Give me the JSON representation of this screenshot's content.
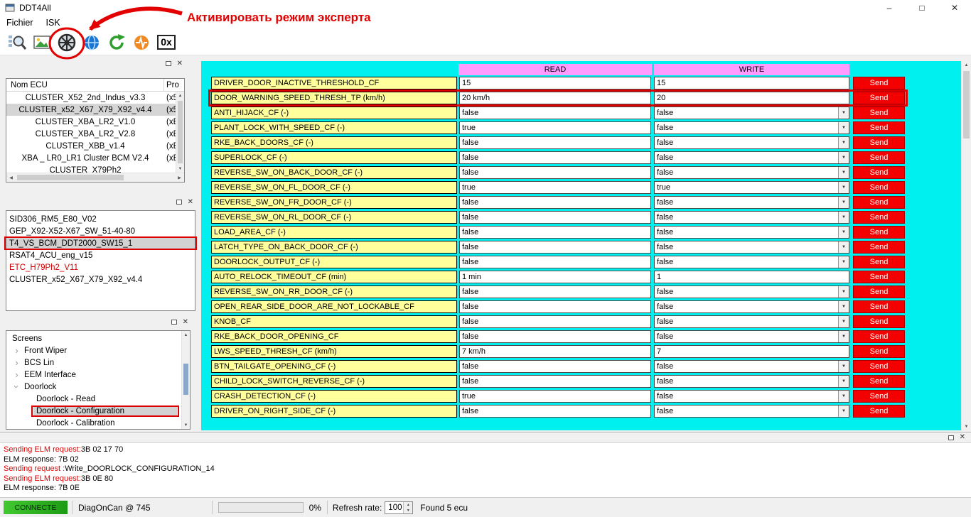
{
  "window": {
    "title": "DDT4All"
  },
  "window_controls": {
    "minimize": "–",
    "maximize": "□",
    "close": "✕"
  },
  "menu": {
    "items": [
      {
        "label": "Fichier"
      },
      {
        "label": "ISK"
      }
    ]
  },
  "toolbar": {
    "hex_label": "0x"
  },
  "annotation": {
    "label": "Активировать режим эксперта"
  },
  "icons": {
    "close": "✕",
    "scroll_up": "▲",
    "scroll_down": "▼",
    "scroll_left": "◀",
    "scroll_right": "▶",
    "dropdown": "▼",
    "spin_up": "▲",
    "spin_down": "▼",
    "tree_collapsed": "›"
  },
  "ecu_panel": {
    "name_header": "Nom ECU",
    "proto_header": "Pro",
    "items": [
      {
        "name": "CLUSTER_X52_2nd_Indus_v3.3",
        "proto": "(x5",
        "selected": false
      },
      {
        "name": "CLUSTER_x52_X67_X79_X92_v4.4",
        "proto": "(x5",
        "selected": true
      },
      {
        "name": "CLUSTER_XBA_LR2_V1.0",
        "proto": "(xB",
        "selected": false
      },
      {
        "name": "CLUSTER_XBA_LR2_V2.8",
        "proto": "(xB",
        "selected": false
      },
      {
        "name": "CLUSTER_XBB_v1.4",
        "proto": "(xB",
        "selected": false
      },
      {
        "name": "XBA _ LR0_LR1 Cluster BCM V2.4",
        "proto": "(xB",
        "selected": false
      },
      {
        "name": "CLUSTER_X79Ph2",
        "proto": "",
        "selected": false
      }
    ]
  },
  "file_panel": {
    "items": [
      {
        "name": "SID306_RM5_E80_V02",
        "selected": false,
        "red": false,
        "outlined": false
      },
      {
        "name": "GEP_X92-X52-X67_SW_51-40-80",
        "selected": false,
        "red": false,
        "outlined": false
      },
      {
        "name": "T4_VS_BCM_DDT2000_SW15_1",
        "selected": true,
        "red": false,
        "outlined": true
      },
      {
        "name": "RSAT4_ACU_eng_v15",
        "selected": false,
        "red": false,
        "outlined": false
      },
      {
        "name": "ETC_H79Ph2_V11",
        "selected": false,
        "red": true,
        "outlined": false
      },
      {
        "name": "CLUSTER_x52_X67_X79_X92_v4.4",
        "selected": false,
        "red": false,
        "outlined": false
      }
    ]
  },
  "screens_panel": {
    "items": [
      {
        "label": "Screens",
        "level": 0,
        "state": "none",
        "selected": false,
        "outlined": false
      },
      {
        "label": "Front Wiper",
        "level": 1,
        "state": "collapsed",
        "selected": false,
        "outlined": false
      },
      {
        "label": "BCS Lin",
        "level": 1,
        "state": "collapsed",
        "selected": false,
        "outlined": false
      },
      {
        "label": "EEM Interface",
        "level": 1,
        "state": "collapsed",
        "selected": false,
        "outlined": false
      },
      {
        "label": "Doorlock",
        "level": 1,
        "state": "expanded",
        "selected": false,
        "outlined": false
      },
      {
        "label": "Doorlock - Read",
        "level": 2,
        "state": "none",
        "selected": false,
        "outlined": false
      },
      {
        "label": "Doorlock - Configuration",
        "level": 2,
        "state": "none",
        "selected": true,
        "outlined": true
      },
      {
        "label": "Doorlock - Calibration",
        "level": 2,
        "state": "none",
        "selected": false,
        "outlined": false
      }
    ]
  },
  "param_table": {
    "read_header": "READ",
    "write_header": "WRITE",
    "send_label": "Send",
    "rows": [
      {
        "label": "DRIVER_DOOR_INACTIVE_THRESHOLD_CF",
        "read": "15",
        "write": "15",
        "type": "input",
        "outlined": false
      },
      {
        "label": "DOOR_WARNING_SPEED_THRESH_TP (km/h)",
        "read": "20 km/h",
        "write": "20",
        "type": "input",
        "outlined": true
      },
      {
        "label": "ANTI_HIJACK_CF (-)",
        "read": "false",
        "write": "false",
        "type": "select",
        "outlined": false
      },
      {
        "label": "PLANT_LOCK_WITH_SPEED_CF (-)",
        "read": "true",
        "write": "false",
        "type": "select",
        "outlined": false
      },
      {
        "label": "RKE_BACK_DOORS_CF (-)",
        "read": "false",
        "write": "false",
        "type": "select",
        "outlined": false
      },
      {
        "label": "SUPERLOCK_CF (-)",
        "read": "false",
        "write": "false",
        "type": "select",
        "outlined": false
      },
      {
        "label": "REVERSE_SW_ON_BACK_DOOR_CF (-)",
        "read": "false",
        "write": "false",
        "type": "select",
        "outlined": false
      },
      {
        "label": "REVERSE_SW_ON_FL_DOOR_CF (-)",
        "read": "true",
        "write": "true",
        "type": "select",
        "outlined": false
      },
      {
        "label": "REVERSE_SW_ON_FR_DOOR_CF (-)",
        "read": "false",
        "write": "false",
        "type": "select",
        "outlined": false
      },
      {
        "label": "REVERSE_SW_ON_RL_DOOR_CF (-)",
        "read": "false",
        "write": "false",
        "type": "select",
        "outlined": false
      },
      {
        "label": "LOAD_AREA_CF (-)",
        "read": "false",
        "write": "false",
        "type": "select",
        "outlined": false
      },
      {
        "label": "LATCH_TYPE_ON_BACK_DOOR_CF (-)",
        "read": "false",
        "write": "false",
        "type": "select",
        "outlined": false
      },
      {
        "label": "DOORLOCK_OUTPUT_CF (-)",
        "read": "false",
        "write": "false",
        "type": "select",
        "outlined": false
      },
      {
        "label": "AUTO_RELOCK_TIMEOUT_CF (min)",
        "read": "1 min",
        "write": "1",
        "type": "input",
        "outlined": false
      },
      {
        "label": "REVERSE_SW_ON_RR_DOOR_CF (-)",
        "read": "false",
        "write": "false",
        "type": "select",
        "outlined": false
      },
      {
        "label": "OPEN_REAR_SIDE_DOOR_ARE_NOT_LOCKABLE_CF",
        "read": "false",
        "write": "false",
        "type": "select",
        "outlined": false
      },
      {
        "label": "KNOB_CF",
        "read": "false",
        "write": "false",
        "type": "select",
        "outlined": false
      },
      {
        "label": "RKE_BACK_DOOR_OPENING_CF",
        "read": "false",
        "write": "false",
        "type": "select",
        "outlined": false
      },
      {
        "label": "LWS_SPEED_THRESH_CF (km/h)",
        "read": "7 km/h",
        "write": "7",
        "type": "input",
        "outlined": false
      },
      {
        "label": "BTN_TAILGATE_OPENING_CF (-)",
        "read": "false",
        "write": "false",
        "type": "select",
        "outlined": false
      },
      {
        "label": "CHILD_LOCK_SWITCH_REVERSE_CF (-)",
        "read": "false",
        "write": "false",
        "type": "select",
        "outlined": false
      },
      {
        "label": "CRASH_DETECTION_CF (-)",
        "read": "true",
        "write": "false",
        "type": "select",
        "outlined": false
      },
      {
        "label": "DRIVER_ON_RIGHT_SIDE_CF (-)",
        "read": "false",
        "write": "false",
        "type": "select",
        "outlined": false
      }
    ]
  },
  "log_panel": {
    "lines": [
      {
        "prefix": "Sending ELM request:",
        "value": "3B 02 17 70",
        "highlight": true
      },
      {
        "prefix": "ELM response: ",
        "value": "7B 02",
        "highlight": false
      },
      {
        "prefix": "Sending request :",
        "value": "Write_DOORLOCK_CONFIGURATION_14",
        "highlight": true
      },
      {
        "prefix": "Sending ELM request:",
        "value": "3B 0E 80",
        "highlight": true
      },
      {
        "prefix": "ELM response: ",
        "value": "7B 0E",
        "highlight": false
      }
    ]
  },
  "status_bar": {
    "connection": "CONNECTE",
    "protocol": "DiagOnCan @ 745",
    "progress": "0%",
    "refresh_label": "Refresh rate:",
    "refresh_value": "100",
    "ecu_found": "Found 5 ecu"
  },
  "colors": {
    "screen_bg": "#00F0F0",
    "header_pink": "#FF9BFF",
    "label_yellow": "#FFFF9C",
    "send_red": "#F40000",
    "annotation_red": "#E00000"
  }
}
